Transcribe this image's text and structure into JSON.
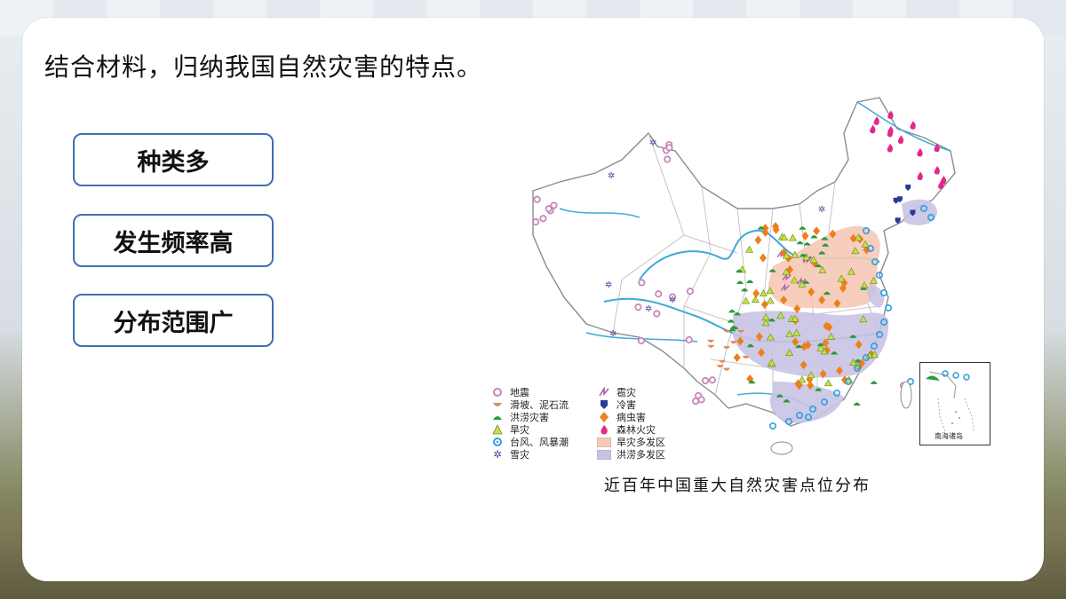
{
  "question": "结合材料，归纳我国自然灾害的特点。",
  "answers": [
    "种类多",
    "发生频率高",
    "分布范围广"
  ],
  "map": {
    "caption": "近百年中国重大自然灾害点位分布",
    "inset_label": "南海诸岛",
    "colors": {
      "drought_region": "#f6c9b6",
      "flood_region": "#c8c3e3",
      "river": "#3fa9d8",
      "border": "#9a9a9a",
      "earthquake": "#c887b8",
      "landslide": "#e08a5a",
      "flood": "#2a9a3e",
      "drought": "#c7e04a",
      "typhoon": "#2f9fe0",
      "snow": "#4a4aa0",
      "hail": "#b05ab0",
      "cold": "#2a3a9a",
      "pest": "#ef7f1a",
      "fire": "#e02a8a"
    },
    "legend": [
      {
        "icon": "earthquake-icon",
        "label": "地震"
      },
      {
        "icon": "landslide-icon",
        "label": "滑坡、泥石流"
      },
      {
        "icon": "flood-icon",
        "label": "洪涝灾害"
      },
      {
        "icon": "drought-icon",
        "label": "旱灾"
      },
      {
        "icon": "typhoon-icon",
        "label": "台风、风暴潮"
      },
      {
        "icon": "snow-icon",
        "label": "雪灾"
      },
      {
        "icon": "hail-icon",
        "label": "雹灾"
      },
      {
        "icon": "cold-icon",
        "label": "冷害"
      },
      {
        "icon": "pest-icon",
        "label": "病虫害"
      },
      {
        "icon": "fire-icon",
        "label": "森林火灾"
      },
      {
        "icon": "drought-region-swatch",
        "label": "旱灾多发区"
      },
      {
        "icon": "flood-region-swatch",
        "label": "洪涝多发区"
      }
    ]
  }
}
